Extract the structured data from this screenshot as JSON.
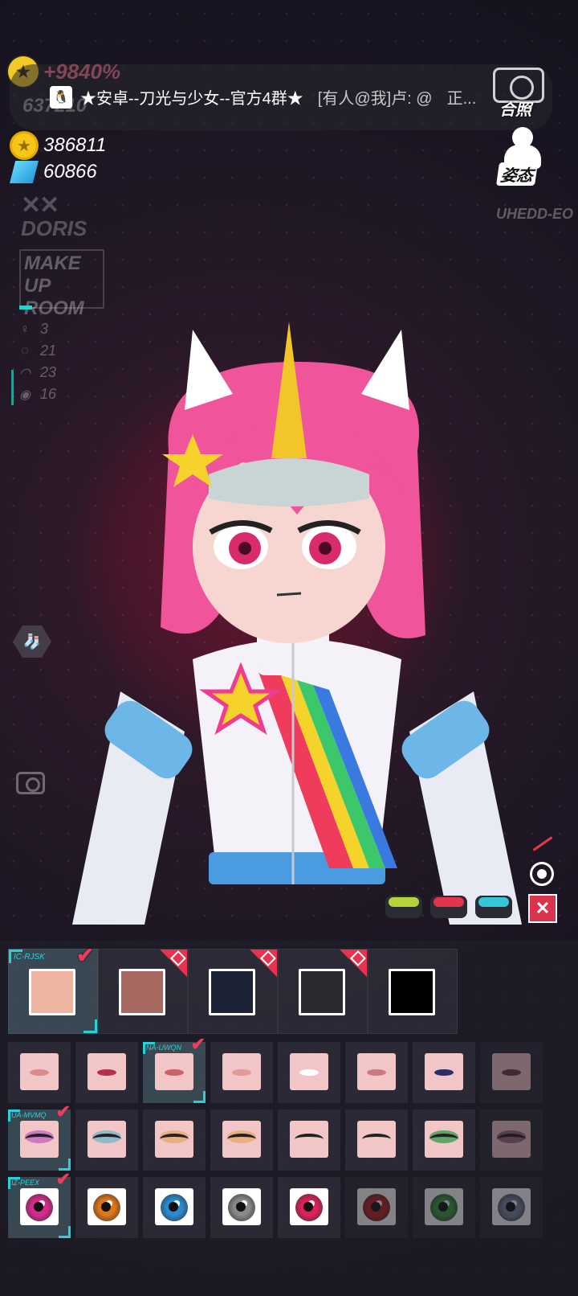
{
  "player": {
    "rank_value": "+9840%",
    "rank_sub": "637210",
    "coins": "386811",
    "gems": "60866",
    "name_mark": "✕✕",
    "name": "DORIS",
    "room_label": "MAKE UP ROOM",
    "uid": "UHEDD-EO"
  },
  "stats": [
    {
      "icon": "figure-icon",
      "glyph": "♀",
      "value": "3"
    },
    {
      "icon": "lips-icon",
      "glyph": "◌",
      "value": "21"
    },
    {
      "icon": "eye-icon",
      "glyph": "◠",
      "value": "23"
    },
    {
      "icon": "iris-icon",
      "glyph": "◉",
      "value": "16"
    }
  ],
  "chat": {
    "icon": "qq-icon",
    "title": "★安卓--刀光与少女--官方4群★",
    "message": "[有人@我]卢: @",
    "trailing": "正..."
  },
  "buttons": {
    "photo_label": "合照",
    "pose_label": "姿态"
  },
  "color_pills": [
    "#b5d43a",
    "#e2344f",
    "#35c6d8"
  ],
  "swatches": [
    {
      "tag": "IC-RJSK",
      "color": "#eeb6a2",
      "selected": true,
      "state": "checked"
    },
    {
      "tag": "",
      "color": "#a86a60",
      "selected": false,
      "state": "locked"
    },
    {
      "tag": "",
      "color": "#1c2336",
      "selected": false,
      "state": "locked"
    },
    {
      "tag": "",
      "color": "#2a2a2f",
      "selected": false,
      "state": "locked"
    },
    {
      "tag": "",
      "color": "#000000",
      "selected": false,
      "state": "none"
    }
  ],
  "lips": {
    "tag": "NA-UWQN",
    "items": [
      {
        "color": "#d98a8a",
        "selected": false,
        "dim": false
      },
      {
        "color": "#b2314a",
        "selected": false,
        "dim": false
      },
      {
        "color": "#c9626a",
        "selected": true,
        "dim": false
      },
      {
        "color": "#e09a98",
        "selected": false,
        "dim": false
      },
      {
        "color": "#ffffff",
        "selected": false,
        "dim": false
      },
      {
        "color": "#c97a80",
        "selected": false,
        "dim": false
      },
      {
        "color": "#2a2f6b",
        "selected": false,
        "dim": false
      },
      {
        "color": "#7a3a3a",
        "selected": false,
        "dim": true
      }
    ]
  },
  "eyes": {
    "tag": "UA-MVMQ",
    "items": [
      {
        "shadow": "#c25fc2",
        "selected": true,
        "dim": false
      },
      {
        "shadow": "#6fb5c9",
        "selected": false,
        "dim": false
      },
      {
        "shadow": "#e6a56a",
        "selected": false,
        "dim": false
      },
      {
        "shadow": "#e6a56a",
        "selected": false,
        "dim": false
      },
      {
        "shadow": "#f0c8c8",
        "selected": false,
        "dim": false
      },
      {
        "shadow": "#f0c8c8",
        "selected": false,
        "dim": false
      },
      {
        "shadow": "#2f9a4a",
        "selected": false,
        "dim": false
      },
      {
        "shadow": "#8a4a6a",
        "selected": false,
        "dim": true
      }
    ]
  },
  "irises": {
    "tag": "IZ-PEEX",
    "items": [
      {
        "color": "#d92a8c",
        "selected": true,
        "dim": false
      },
      {
        "color": "#e0781a",
        "selected": false,
        "dim": false
      },
      {
        "color": "#2a8ad0",
        "selected": false,
        "dim": false
      },
      {
        "color": "#8a8a8a",
        "selected": false,
        "dim": false
      },
      {
        "color": "#e0205a",
        "selected": false,
        "dim": false
      },
      {
        "color": "#c02020",
        "selected": false,
        "dim": true
      },
      {
        "color": "#3aa040",
        "selected": false,
        "dim": true
      },
      {
        "color": "#7a8aa0",
        "selected": false,
        "dim": true
      }
    ]
  }
}
